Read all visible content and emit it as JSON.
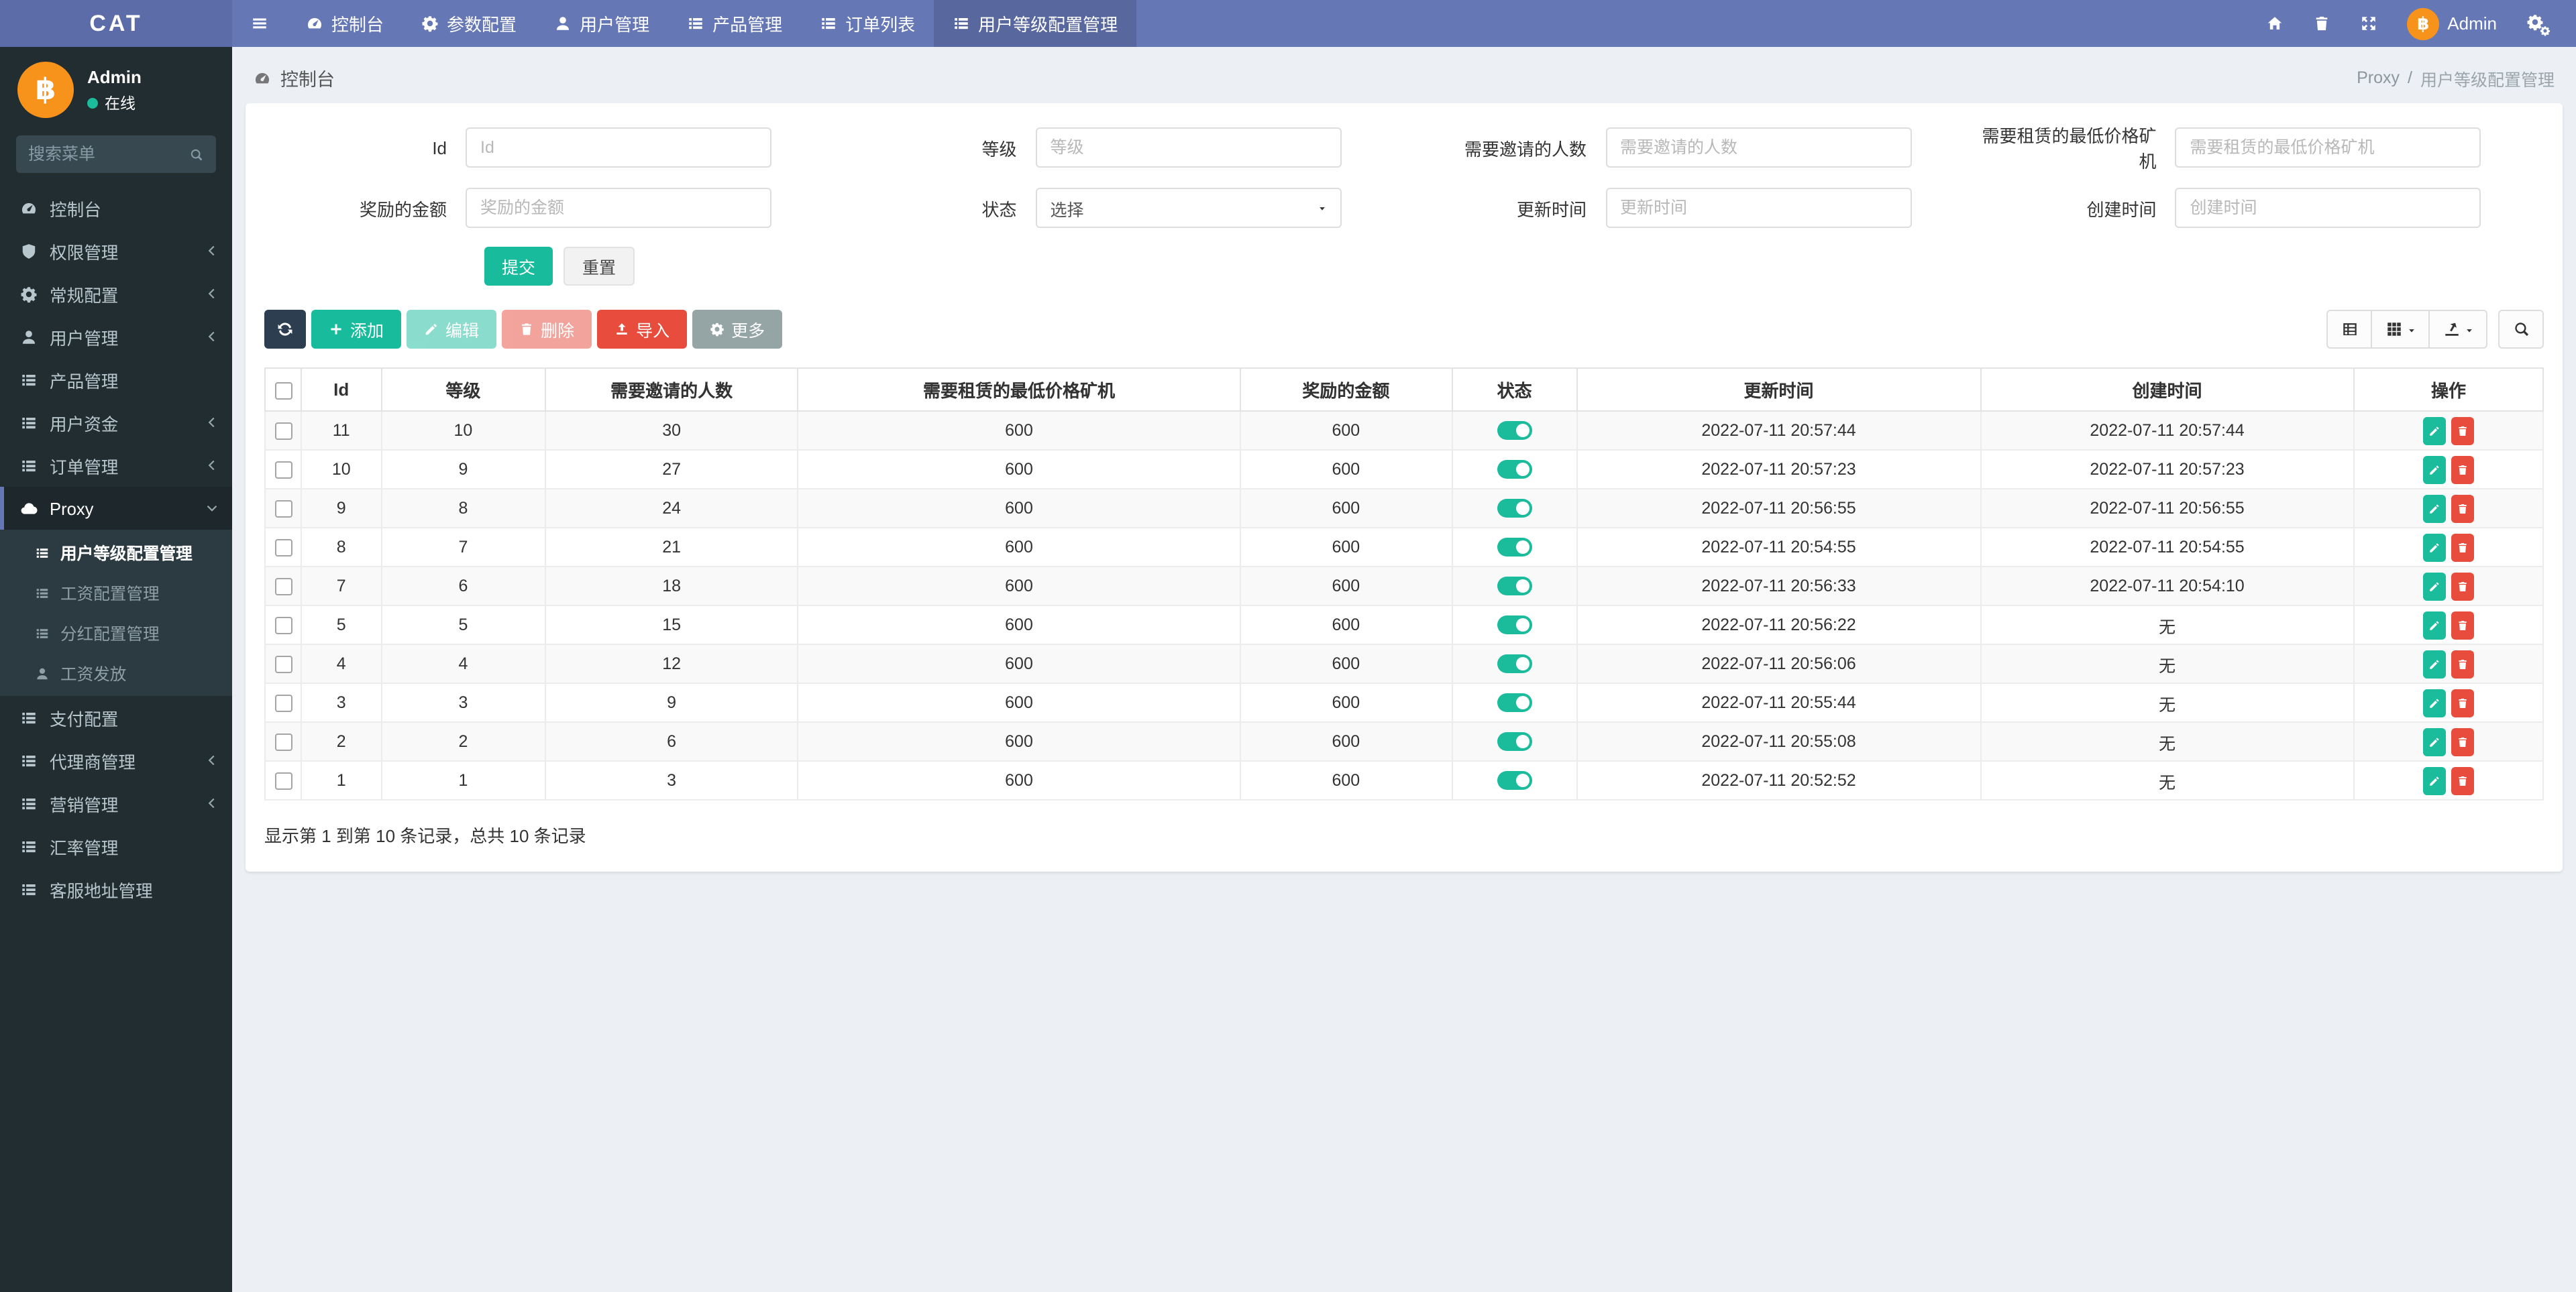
{
  "navbar": {
    "brand": "CAT",
    "items": [
      {
        "label": "控制台",
        "icon": "dashboard-icon"
      },
      {
        "label": "参数配置",
        "icon": "gear-icon"
      },
      {
        "label": "用户管理",
        "icon": "user-icon"
      },
      {
        "label": "产品管理",
        "icon": "list-icon"
      },
      {
        "label": "订单列表",
        "icon": "list-icon"
      },
      {
        "label": "用户等级配置管理",
        "icon": "list-icon",
        "active": true
      }
    ],
    "right_icons": [
      "home-icon",
      "trash-icon",
      "fullscreen-icon",
      "bitcoin-avatar",
      "gears-icon"
    ],
    "user": {
      "name": "Admin",
      "avatar_symbol": "฿",
      "avatar_color": "#f7931a"
    }
  },
  "sidebar": {
    "user": {
      "name": "Admin",
      "status": "在线"
    },
    "search": {
      "placeholder": "搜索菜单"
    },
    "items": [
      {
        "label": "控制台",
        "icon": "dashboard-icon"
      },
      {
        "label": "权限管理",
        "icon": "shield-icon",
        "has_children": true
      },
      {
        "label": "常规配置",
        "icon": "gears-icon",
        "has_children": true
      },
      {
        "label": "用户管理",
        "icon": "user-icon",
        "has_children": true
      },
      {
        "label": "产品管理",
        "icon": "list-icon"
      },
      {
        "label": "用户资金",
        "icon": "list-icon",
        "has_children": true
      },
      {
        "label": "订单管理",
        "icon": "list-icon",
        "has_children": true
      },
      {
        "label": "Proxy",
        "icon": "cloud-icon",
        "expanded": true,
        "active": true
      },
      {
        "label": "支付配置",
        "icon": "list-icon"
      },
      {
        "label": "代理商管理",
        "icon": "list-icon",
        "has_children": true
      },
      {
        "label": "营销管理",
        "icon": "list-icon",
        "has_children": true
      },
      {
        "label": "汇率管理",
        "icon": "list-icon"
      },
      {
        "label": "客服地址管理",
        "icon": "list-icon"
      }
    ],
    "proxy_children": [
      {
        "label": "用户等级配置管理",
        "icon": "list-icon",
        "active": true
      },
      {
        "label": "工资配置管理",
        "icon": "list-icon"
      },
      {
        "label": "分红配置管理",
        "icon": "list-icon"
      },
      {
        "label": "工资发放",
        "icon": "person-icon"
      }
    ]
  },
  "breadcrumb": {
    "left": "控制台",
    "parent": "Proxy",
    "current": "用户等级配置管理"
  },
  "filters": {
    "fields": [
      {
        "label": "Id",
        "placeholder": "Id"
      },
      {
        "label": "等级",
        "placeholder": "等级"
      },
      {
        "label": "需要邀请的人数",
        "placeholder": "需要邀请的人数"
      },
      {
        "label": "需要租赁的最低价格矿机",
        "placeholder": "需要租赁的最低价格矿机"
      },
      {
        "label": "奖励的金额",
        "placeholder": "奖励的金额"
      },
      {
        "label": "状态",
        "value": "选择",
        "type": "select"
      },
      {
        "label": "更新时间",
        "placeholder": "更新时间"
      },
      {
        "label": "创建时间",
        "placeholder": "创建时间"
      }
    ],
    "submit": "提交",
    "reset": "重置"
  },
  "toolbar": {
    "add": "添加",
    "edit": "编辑",
    "delete": "删除",
    "import": "导入",
    "more": "更多"
  },
  "table": {
    "columns": [
      "Id",
      "等级",
      "需要邀请的人数",
      "需要租赁的最低价格矿机",
      "奖励的金额",
      "状态",
      "更新时间",
      "创建时间",
      "操作"
    ],
    "rows": [
      {
        "id": "11",
        "level": "10",
        "invite_count": "30",
        "min_rent_price": "600",
        "reward_amount": "600",
        "status": true,
        "updated_at": "2022-07-11 20:57:44",
        "created_at": "2022-07-11 20:57:44"
      },
      {
        "id": "10",
        "level": "9",
        "invite_count": "27",
        "min_rent_price": "600",
        "reward_amount": "600",
        "status": true,
        "updated_at": "2022-07-11 20:57:23",
        "created_at": "2022-07-11 20:57:23"
      },
      {
        "id": "9",
        "level": "8",
        "invite_count": "24",
        "min_rent_price": "600",
        "reward_amount": "600",
        "status": true,
        "updated_at": "2022-07-11 20:56:55",
        "created_at": "2022-07-11 20:56:55"
      },
      {
        "id": "8",
        "level": "7",
        "invite_count": "21",
        "min_rent_price": "600",
        "reward_amount": "600",
        "status": true,
        "updated_at": "2022-07-11 20:54:55",
        "created_at": "2022-07-11 20:54:55"
      },
      {
        "id": "7",
        "level": "6",
        "invite_count": "18",
        "min_rent_price": "600",
        "reward_amount": "600",
        "status": true,
        "updated_at": "2022-07-11 20:56:33",
        "created_at": "2022-07-11 20:54:10"
      },
      {
        "id": "5",
        "level": "5",
        "invite_count": "15",
        "min_rent_price": "600",
        "reward_amount": "600",
        "status": true,
        "updated_at": "2022-07-11 20:56:22",
        "created_at": "无"
      },
      {
        "id": "4",
        "level": "4",
        "invite_count": "12",
        "min_rent_price": "600",
        "reward_amount": "600",
        "status": true,
        "updated_at": "2022-07-11 20:56:06",
        "created_at": "无"
      },
      {
        "id": "3",
        "level": "3",
        "invite_count": "9",
        "min_rent_price": "600",
        "reward_amount": "600",
        "status": true,
        "updated_at": "2022-07-11 20:55:44",
        "created_at": "无"
      },
      {
        "id": "2",
        "level": "2",
        "invite_count": "6",
        "min_rent_price": "600",
        "reward_amount": "600",
        "status": true,
        "updated_at": "2022-07-11 20:55:08",
        "created_at": "无"
      },
      {
        "id": "1",
        "level": "1",
        "invite_count": "3",
        "min_rent_price": "600",
        "reward_amount": "600",
        "status": true,
        "updated_at": "2022-07-11 20:52:52",
        "created_at": "无"
      }
    ]
  },
  "summary": "显示第 1 到第 10 条记录，总共 10 条记录",
  "colors": {
    "navbar": "#6577b4",
    "sidebar": "#222d32",
    "teal": "#18bc9c",
    "navy": "#2c3e50",
    "red": "#e74c3c",
    "gray_button": "#95a5a6",
    "content_bg": "#ecf0f5",
    "avatar_orange": "#f7931a",
    "toggle_on": "#1abc9c"
  }
}
